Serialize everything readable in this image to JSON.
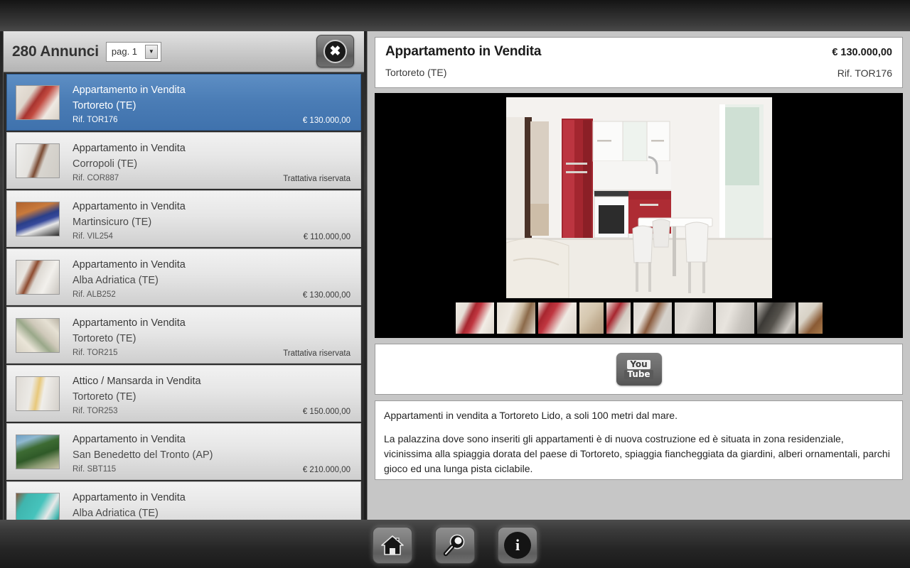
{
  "window": {
    "close_label": "✖"
  },
  "list_header": {
    "count_label": "280 Annunci",
    "page_selector": {
      "value": "pag. 1",
      "arrow": "▼"
    }
  },
  "listings": [
    {
      "title": "Appartamento in Vendita",
      "place": "Tortoreto (TE)",
      "ref": "Rif. TOR176",
      "price": "€ 130.000,00",
      "selected": true
    },
    {
      "title": "Appartamento in Vendita",
      "place": "Corropoli (TE)",
      "ref": "Rif. COR887",
      "price": "Trattativa riservata",
      "selected": false
    },
    {
      "title": "Appartamento in Vendita",
      "place": "Martinsicuro (TE)",
      "ref": "Rif. VIL254",
      "price": "€ 110.000,00",
      "selected": false
    },
    {
      "title": "Appartamento in Vendita",
      "place": "Alba Adriatica (TE)",
      "ref": "Rif. ALB252",
      "price": "€ 130.000,00",
      "selected": false
    },
    {
      "title": "Appartamento in Vendita",
      "place": "Tortoreto (TE)",
      "ref": "Rif. TOR215",
      "price": "Trattativa riservata",
      "selected": false
    },
    {
      "title": "Attico / Mansarda in Vendita",
      "place": "Tortoreto (TE)",
      "ref": "Rif. TOR253",
      "price": "€ 150.000,00",
      "selected": false
    },
    {
      "title": "Appartamento in Vendita",
      "place": "San Benedetto del Tronto (AP)",
      "ref": "Rif. SBT115",
      "price": "€ 210.000,00",
      "selected": false
    },
    {
      "title": "Appartamento in Vendita",
      "place": "Alba Adriatica (TE)",
      "ref": "",
      "price": "",
      "selected": false
    }
  ],
  "detail": {
    "title": "Appartamento in Vendita",
    "place": "Tortoreto (TE)",
    "price": "€ 130.000,00",
    "ref": "Rif. TOR176",
    "gallery": {
      "thumbnail_count": 10
    },
    "video": {
      "button_icon": "youtube-icon",
      "you": "You",
      "tube": "Tube"
    },
    "description": {
      "para1": "Appartamenti in vendita a Tortoreto Lido, a soli 100 metri dal mare.",
      "para2": "La palazzina dove sono inseriti gli appartamenti è di nuova costruzione ed è situata in zona residenziale, vicinissima alla spiaggia dorata del paese di Tortoreto, spiaggia fiancheggiata da giardini, alberi ornamentali, parchi gioco ed una lunga pista ciclabile."
    }
  },
  "toolbar": {
    "home_icon": "home-icon",
    "search_icon": "magnifier-icon",
    "info_icon": "info-icon",
    "info_glyph": "i"
  },
  "colors": {
    "selection_blue": "#4a7cb5",
    "panel_grey": "#c6c6c6",
    "chrome_dark": "#2b2b2b"
  }
}
